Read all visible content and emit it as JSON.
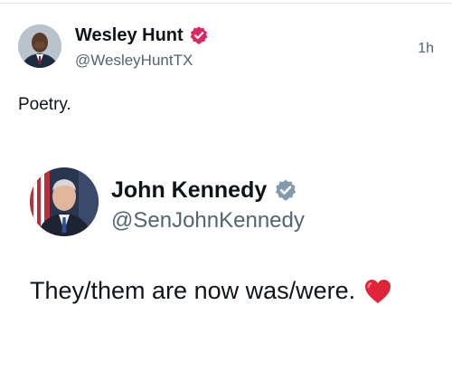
{
  "tweet": {
    "author_name": "Wesley Hunt",
    "author_handle": "@WesleyHuntTX",
    "timestamp": "1h",
    "text": "Poetry.",
    "verified_badge_icon": "verified-badge-icon",
    "verified_color": "#e0245e"
  },
  "quoted_tweet": {
    "author_name": "John Kennedy",
    "author_handle": "@SenJohnKennedy",
    "text": "They/them are now was/were.",
    "verified_badge_icon": "verified-badge-icon",
    "verified_color": "#829aab",
    "emoji": "red-heart-icon"
  },
  "colors": {
    "text_primary": "#0f1419",
    "text_secondary": "#536471",
    "heart": "#e0243a"
  }
}
